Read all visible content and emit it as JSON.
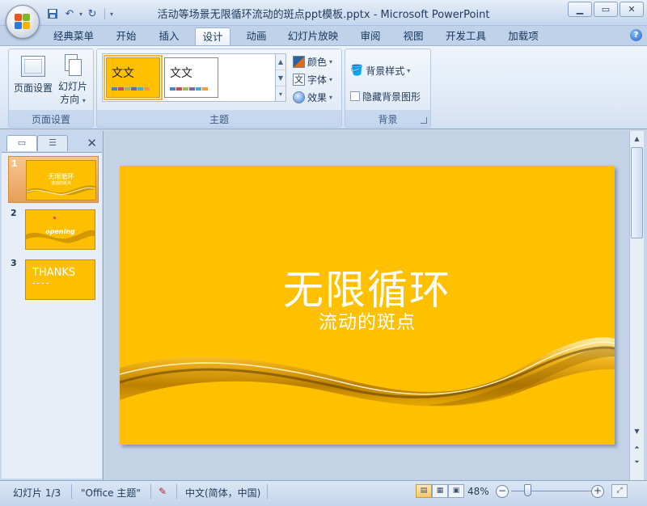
{
  "window": {
    "title": "活动等场景无限循环流动的斑点ppt模板.pptx - Microsoft PowerPoint",
    "minimize_icon": "minimize-icon",
    "maximize_icon": "maximize-icon",
    "close_icon": "close-icon"
  },
  "quick_access": {
    "save_icon": "save-icon",
    "undo_icon": "undo-icon",
    "redo_icon": "redo-icon",
    "customize_icon": "customize-icon"
  },
  "ribbon": {
    "tabs": [
      "经典菜单",
      "开始",
      "插入",
      "设计",
      "动画",
      "幻灯片放映",
      "审阅",
      "视图",
      "开发工具",
      "加载项"
    ],
    "active_tab": "设计",
    "page_setup": {
      "group_label": "页面设置",
      "page_setup_label": "页面设置",
      "orientation_label_1": "幻灯片",
      "orientation_label_2": "方向"
    },
    "themes": {
      "group_label": "主题",
      "theme1_text": "文文",
      "theme2_text": "文文",
      "colors_label": "颜色",
      "fonts_label": "字体",
      "effects_label": "效果"
    },
    "background": {
      "group_label": "背景",
      "styles_label": "背景样式",
      "hide_label": "隐藏背景图形",
      "hide_checked": false
    }
  },
  "slides_pane": {
    "slides": [
      {
        "number": "1",
        "title": "无限循环",
        "subtitle": "流动的斑点",
        "selected": true
      },
      {
        "number": "2",
        "title": "opening",
        "selected": false
      },
      {
        "number": "3",
        "title": "THANKS",
        "selected": false
      }
    ]
  },
  "slide": {
    "title": "无限循环",
    "subtitle": "流动的斑点",
    "background_color": "#ffc000"
  },
  "status_bar": {
    "slide_info": "幻灯片 1/3",
    "theme": "\"Office 主题\"",
    "language": "中文(简体，中国)",
    "zoom": "48%",
    "zoom_value": 0.48
  },
  "colors": {
    "accent": "#ffc000",
    "ribbon_bg": "#dfe9f6",
    "selection": "#f3b43f"
  }
}
